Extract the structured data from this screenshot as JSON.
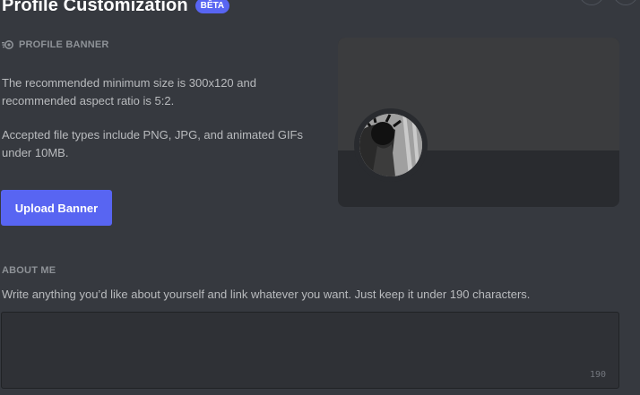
{
  "header": {
    "title": "Profile Customization",
    "badge": "BÊTA"
  },
  "banner_section": {
    "heading": "PROFILE BANNER",
    "icon": "nitro-icon",
    "text_size": "The recommended minimum size is 300x120 and recommended aspect ratio is 5:2.",
    "text_types": "Accepted file types include PNG, JPG, and animated GIFs under 10MB.",
    "upload_label": "Upload Banner"
  },
  "about_section": {
    "heading": "ABOUT ME",
    "description": "Write anything you’d like about yourself and link whatever you want. Just keep it under 190 characters.",
    "value": "",
    "counter": "190"
  },
  "colors": {
    "background": "#36393f",
    "accent": "#5865f2",
    "input_bg": "#2f3136"
  }
}
